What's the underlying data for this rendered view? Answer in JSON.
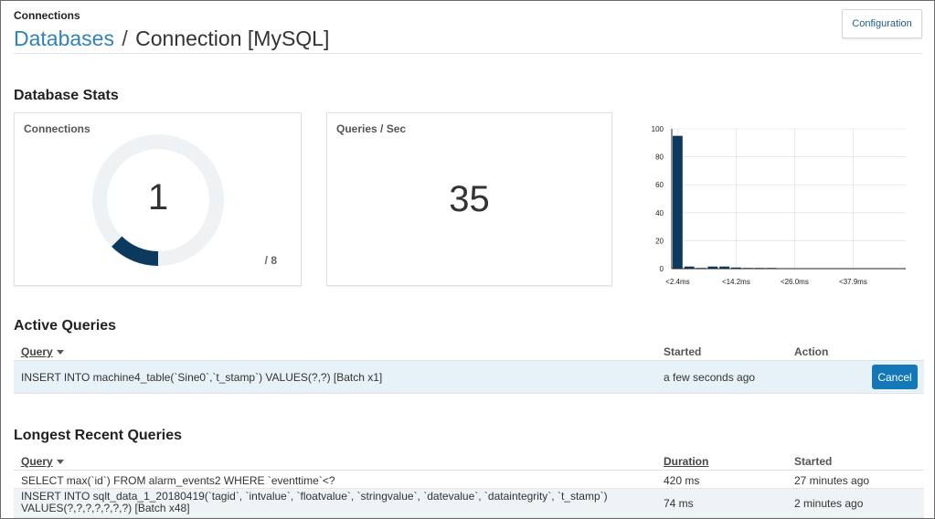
{
  "header": {
    "section": "Connections",
    "breadcrumb_link": "Databases",
    "breadcrumb_sep": "/",
    "breadcrumb_current": "Connection [MySQL]",
    "config_button": "Configuration"
  },
  "stats": {
    "title": "Database Stats",
    "connections": {
      "label": "Connections",
      "value": "1",
      "max": "/ 8",
      "fraction": 0.125
    },
    "qps": {
      "label": "Queries / Sec",
      "value": "35"
    }
  },
  "chart_data": {
    "type": "bar",
    "categories": [
      "<2.4ms",
      "",
      "",
      "",
      "",
      "<14.2ms",
      "",
      "",
      "",
      "",
      "<26.0ms",
      "",
      "",
      "",
      "",
      "<37.9ms",
      "",
      "",
      "",
      ""
    ],
    "values": [
      95,
      1.5,
      0.5,
      1.5,
      1.5,
      0.8,
      0.5,
      0.5,
      0.5,
      0.3,
      0.3,
      0.3,
      0.3,
      0.3,
      0.3,
      0.2,
      0.2,
      0.2,
      0.2,
      0.2
    ],
    "yticks": [
      "0",
      "20",
      "40",
      "60",
      "80",
      "100"
    ],
    "ylim": [
      0,
      100
    ],
    "grid": true,
    "bar_color": "#0b3a5e"
  },
  "active": {
    "title": "Active Queries",
    "headers": {
      "query": "Query",
      "started": "Started",
      "action": "Action"
    },
    "rows": [
      {
        "query": "INSERT INTO machine4_table(`Sine0`,`t_stamp`) VALUES(?,?) [Batch x1]",
        "started": "a few seconds ago",
        "action": "Cancel"
      }
    ]
  },
  "longest": {
    "title": "Longest Recent Queries",
    "headers": {
      "query": "Query",
      "duration": "Duration",
      "started": "Started"
    },
    "rows": [
      {
        "query1": "SELECT max(`id`) FROM alarm_events2 WHERE `eventtime`<?",
        "query2": "",
        "duration": "420 ms",
        "started": "27 minutes ago"
      },
      {
        "query1": "INSERT INTO sqlt_data_1_20180419(`tagid`, `intvalue`, `floatvalue`, `stringvalue`, `datevalue`, `dataintegrity`, `t_stamp`)",
        "query2": "VALUES(?,?,?,?,?,?,?) [Batch x48]",
        "duration": "74 ms",
        "started": "2 minutes ago"
      }
    ]
  },
  "colors": {
    "accent": "#2f83b8",
    "gauge_fill": "#0b3a5e",
    "gauge_track": "#eef2f5",
    "button": "#1478b8"
  }
}
